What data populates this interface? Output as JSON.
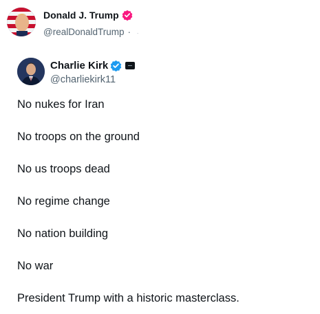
{
  "retweeter": {
    "name": "Donald J. Trump",
    "handle": "@realDonaldTrump",
    "separator": "·",
    "trailing": ".",
    "badge_color": "#f91880"
  },
  "quoted": {
    "name": "Charlie Kirk",
    "handle": "@charliekirk11",
    "verified_color": "#1d9bf0"
  },
  "tweet_lines": [
    "No nukes for Iran",
    "No troops on the ground",
    "No us troops dead",
    "No regime change",
    "No nation building",
    "No war",
    "President Trump with a historic masterclass."
  ]
}
